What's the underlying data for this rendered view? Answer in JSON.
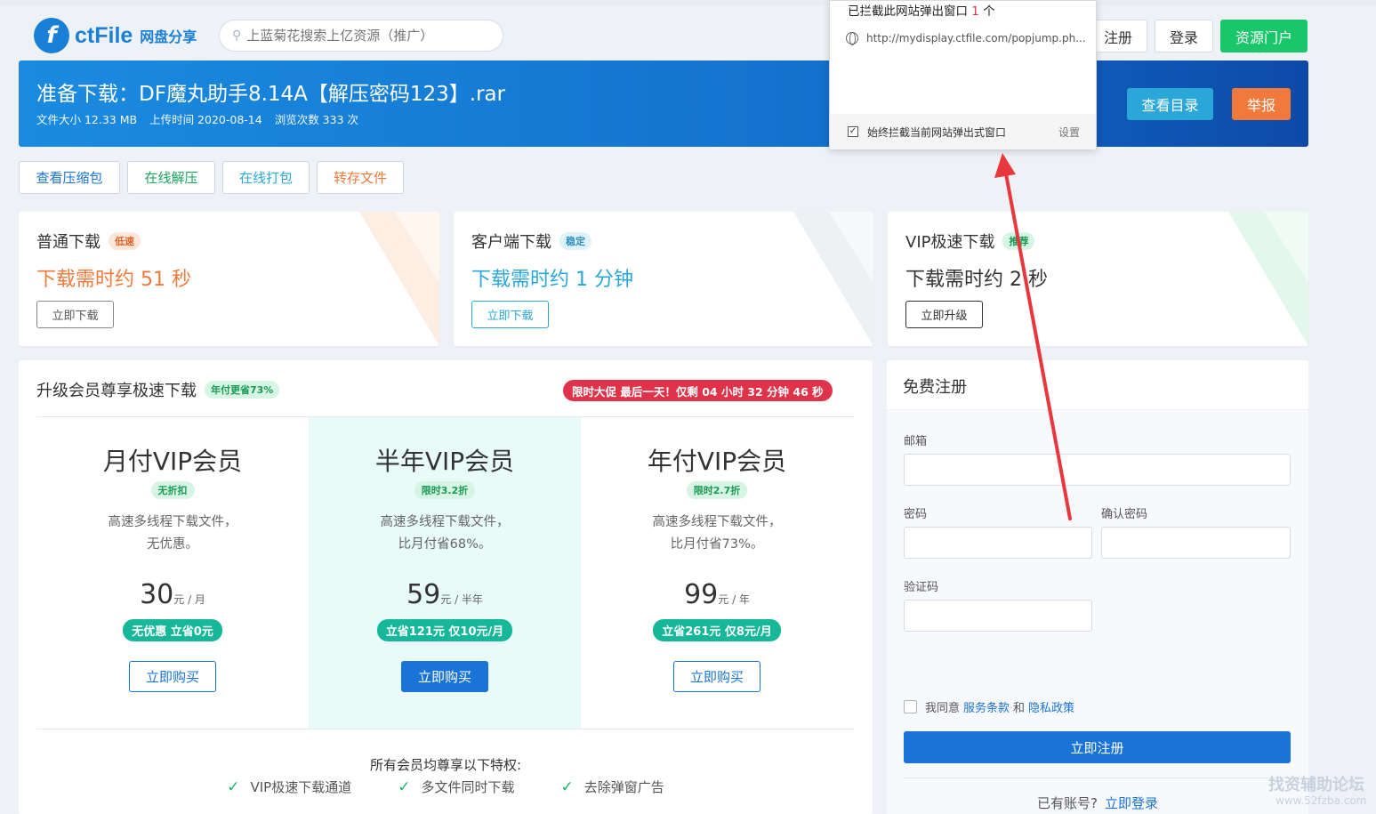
{
  "header": {
    "logo_text": "ctFile",
    "logo_sub": "网盘分享",
    "search_placeholder": "上蓝菊花搜索上亿资源（推广）",
    "register": "注册",
    "login": "登录",
    "portal": "资源门户"
  },
  "banner": {
    "title": "准备下载：DF魔丸助手8.14A【解压密码123】.rar",
    "size": "文件大小 12.33 MB",
    "upload": "上传时间 2020-08-14",
    "views": "浏览次数 333 次",
    "catalog_button": "查看目录",
    "report_button": "举报"
  },
  "toolbar": [
    "查看压缩包",
    "在线解压",
    "在线打包",
    "转存文件"
  ],
  "download_cards": [
    {
      "title": "普通下载",
      "tag": "低速",
      "time": "下载需时约 51 秒",
      "button": "立即下载"
    },
    {
      "title": "客户端下载",
      "tag": "稳定",
      "time": "下载需时约 1 分钟",
      "button": "立即下载"
    },
    {
      "title": "VIP极速下载",
      "tag": "推荐",
      "time": "下载需时约 2 秒",
      "button": "立即升级"
    }
  ],
  "vip": {
    "title": "升级会员尊享极速下载",
    "title_tag": "年付更省73%",
    "promo": "限时大促 最后一天！仅剩 04 小时 32 分钟 46 秒",
    "plans": [
      {
        "name": "月付VIP会员",
        "tag": "无折扣",
        "desc1": "高速多线程下载文件，",
        "desc2": "无优惠。",
        "price": "30",
        "unit": "元 / 月",
        "save": "无优惠 立省0元",
        "buy": "立即购买"
      },
      {
        "name": "半年VIP会员",
        "tag": "限时3.2折",
        "desc1": "高速多线程下载文件，",
        "desc2": "比月付省68%。",
        "price": "59",
        "unit": "元 / 半年",
        "save": "立省121元 仅10元/月",
        "buy": "立即购买"
      },
      {
        "name": "年付VIP会员",
        "tag": "限时2.7折",
        "desc1": "高速多线程下载文件，",
        "desc2": "比月付省73%。",
        "price": "99",
        "unit": "元 / 年",
        "save": "立省261元 仅8元/月",
        "buy": "立即购买"
      }
    ],
    "perks_title": "所有会员均尊享以下特权:",
    "perks": [
      "VIP极速下载通道",
      "多文件同时下载",
      "去除弹窗广告"
    ]
  },
  "register": {
    "title": "免费注册",
    "email_label": "邮箱",
    "password_label": "密码",
    "confirm_label": "确认密码",
    "captcha_label": "验证码",
    "agree_prefix": "我同意",
    "terms": "服务条款",
    "and": "和",
    "privacy": "隐私政策",
    "submit": "立即注册",
    "have_account": "已有账号?",
    "login_link": "立即登录"
  },
  "popup": {
    "title_prefix": "已拦截此网站弹出窗口",
    "count": "1",
    "title_suffix": "个",
    "url": "http://mydisplay.ctfile.com/popjump.ph...",
    "always_block": "始终拦截当前网站弹出式窗口",
    "settings": "设置"
  },
  "watermark": {
    "line1": "找资辅助论坛",
    "line2": "www.52fzba.com"
  },
  "colors": {
    "brand": "#1a7fd6",
    "green": "#19c66a",
    "orange": "#f0793b",
    "teal": "#2aa7d8",
    "red": "#e0334a",
    "arrow": "#e8383d"
  }
}
